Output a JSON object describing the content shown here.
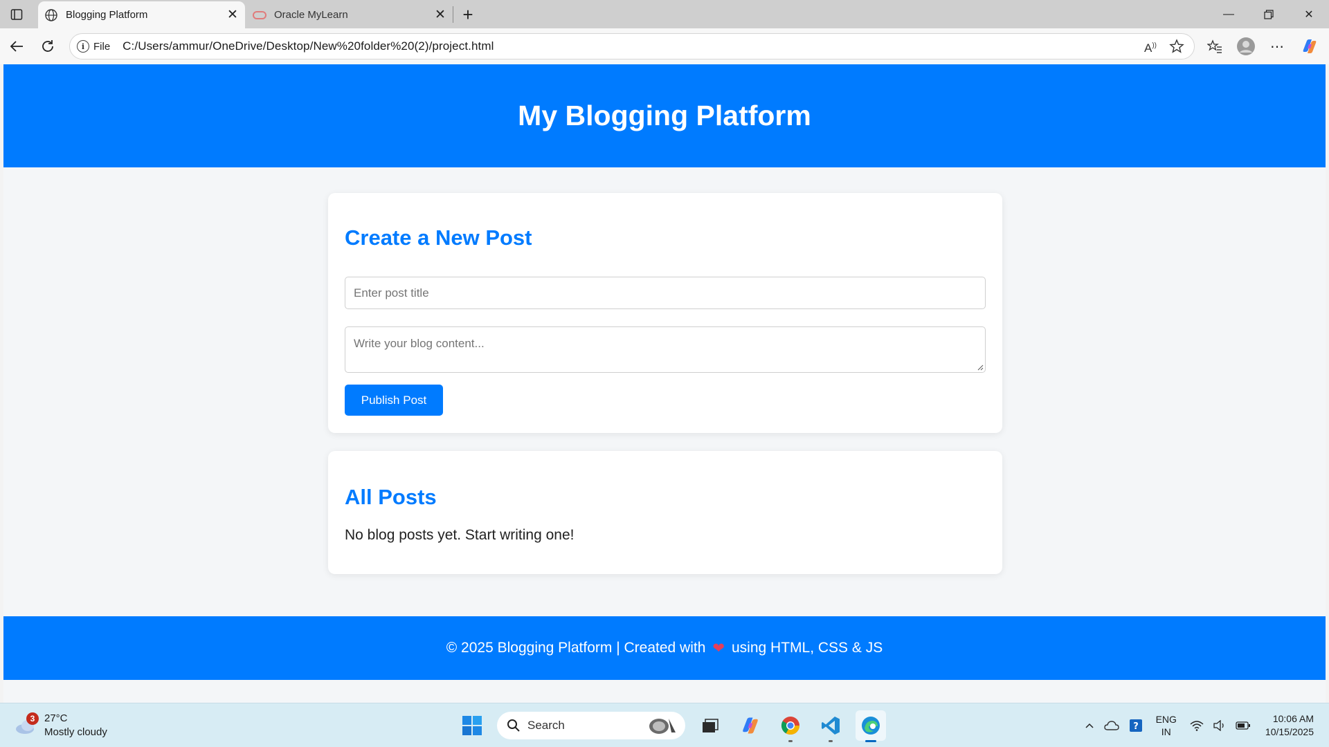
{
  "browser": {
    "tabs": [
      {
        "title": "Blogging Platform",
        "active": true,
        "icon": "globe-icon"
      },
      {
        "title": "Oracle MyLearn",
        "active": false,
        "icon": "oracle-icon"
      }
    ],
    "address": {
      "scheme_label": "File",
      "url": "C:/Users/ammur/OneDrive/Desktop/New%20folder%20(2)/project.html"
    }
  },
  "page": {
    "header_title": "My Blogging Platform",
    "create": {
      "heading": "Create a New Post",
      "title_placeholder": "Enter post title",
      "content_placeholder": "Write your blog content...",
      "publish_label": "Publish Post"
    },
    "posts": {
      "heading": "All Posts",
      "empty_message": "No blog posts yet. Start writing one!"
    },
    "footer": {
      "before": "© 2025 Blogging Platform | Created with",
      "heart": "❤",
      "after": "using HTML, CSS & JS"
    },
    "colors": {
      "primary": "#007bff",
      "background": "#f4f6f8"
    }
  },
  "taskbar": {
    "weather": {
      "badge": "3",
      "temp": "27°C",
      "condition": "Mostly cloudy"
    },
    "search_label": "Search",
    "language": {
      "line1": "ENG",
      "line2": "IN"
    },
    "clock": {
      "time": "10:06 AM",
      "date": "10/15/2025"
    }
  }
}
